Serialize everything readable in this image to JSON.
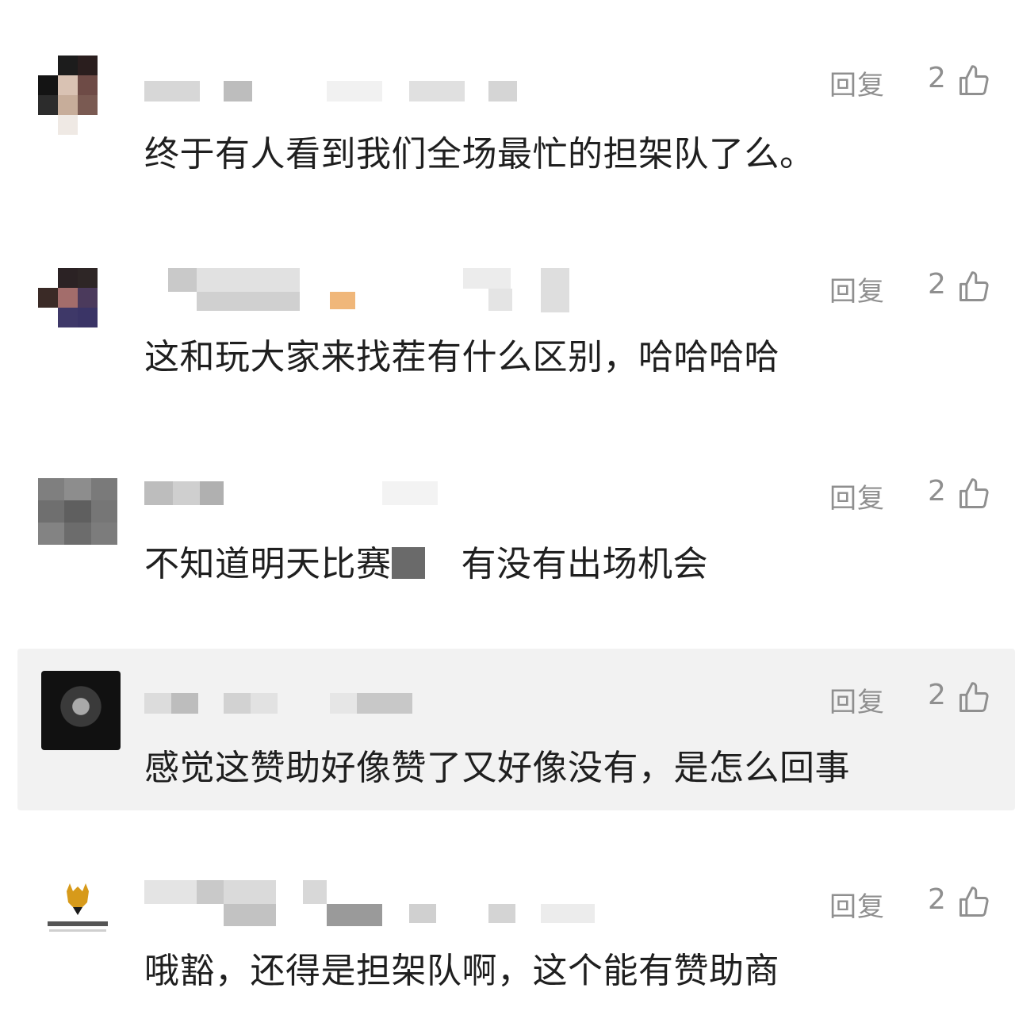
{
  "comments": [
    {
      "reply_label": "回复",
      "likes": "2",
      "text": "终于有人看到我们全场最忙的担架队了么。"
    },
    {
      "reply_label": "回复",
      "likes": "2",
      "text": "这和玩大家来找茬有什么区别，哈哈哈哈"
    },
    {
      "reply_label": "回复",
      "likes": "2",
      "text_before": "不知道明天比赛",
      "text_after": "有没有出场机会"
    },
    {
      "reply_label": "回复",
      "likes": "2",
      "text": "感觉这赞助好像赞了又好像没有，是怎么回事"
    },
    {
      "reply_label": "回复",
      "likes": "2",
      "text": "哦豁，还得是担架队啊，这个能有赞助商"
    }
  ],
  "colors": {
    "highlight_bg": "#f2f2f2",
    "meta_gray": "#8f8f8f",
    "text": "#1f1f1f"
  },
  "icons": [
    "thumbs-up-icon"
  ]
}
